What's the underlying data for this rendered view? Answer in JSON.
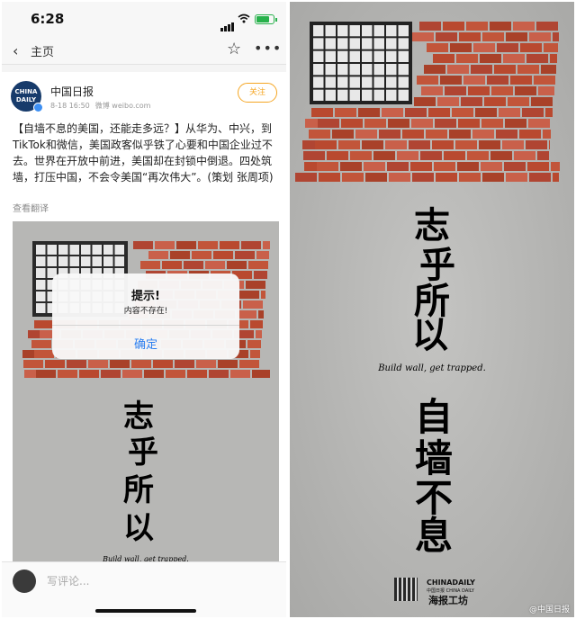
{
  "status_bar": {
    "time": "6:28",
    "battery_level": 0.8
  },
  "nav": {
    "back_label": "主页"
  },
  "post": {
    "avatar_text_line1": "CHINA",
    "avatar_text_line2": "DAILY",
    "username": "中国日报",
    "date": "8-18 16:50",
    "source": "微博 weibo.com",
    "follow_label": "关注",
    "text": "【自墙不息的美国，还能走多远？】从华为、中兴，到TikTok和微信，美国政客似乎铁了心要和中国企业过不去。世界在开放中前进，美国却在封锁中倒退。四处筑墙，打压中国，不会令美国“再次伟大”。(策划 张周项)",
    "translate_label": "查看翻译",
    "image_calligraphy": [
      "志",
      "乎",
      "所",
      "以"
    ],
    "image_tagline": "Build wall, get trapped."
  },
  "dialog": {
    "title": "提示!",
    "message": "内容不存在!",
    "ok_label": "确定"
  },
  "comment": {
    "placeholder": "写评论..."
  },
  "poster": {
    "calligraphy_top": [
      "志",
      "乎",
      "所",
      "以"
    ],
    "tagline": "Build wall, get trapped.",
    "calligraphy_bottom": [
      "自",
      "墙",
      "不",
      "息"
    ],
    "brand_top": "CHINADAILY",
    "brand_sub": "中国日报 CHINA DAILY",
    "brand_bottom": "海报工坊",
    "watermark": "@中国日报"
  },
  "colors": {
    "brick": "#b9492f",
    "mortar": "#d8d3cc",
    "follow": "#f5a623",
    "link": "#2c7ff0",
    "battery": "#27b14b"
  }
}
